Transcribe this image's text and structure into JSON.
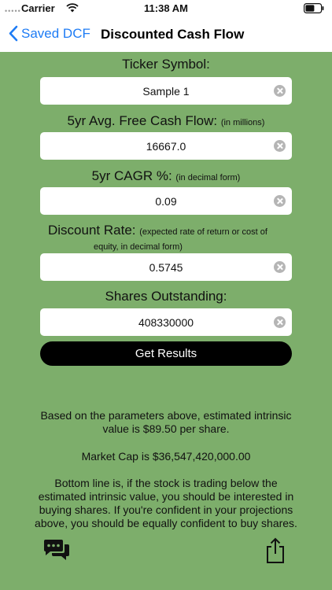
{
  "status": {
    "dots": "•••••",
    "carrier": "Carrier",
    "time": "11:38 AM"
  },
  "nav": {
    "back_label": "Saved DCF",
    "title": "Discounted Cash Flow"
  },
  "form": {
    "ticker": {
      "label": "Ticker Symbol:",
      "value": "Sample 1"
    },
    "fcf": {
      "label": "5yr Avg. Free Cash Flow:",
      "hint": "(in millions)",
      "value": "16667.0"
    },
    "cagr": {
      "label": "5yr CAGR %:",
      "hint": "(in decimal form)",
      "value": "0.09"
    },
    "discount": {
      "label": "Discount Rate:",
      "hint_line1": "(expected rate of return or cost of",
      "hint_line2": "equity, in decimal form)",
      "value": "0.5745"
    },
    "shares": {
      "label": "Shares Outstanding:",
      "value": "408330000"
    }
  },
  "button": {
    "label": "Get Results"
  },
  "results": {
    "intrinsic": "Based on the parameters above, estimated intrinsic value is $89.50 per share.",
    "market_cap": "Market Cap is $36,547,420,000.00",
    "bottom_line": "Bottom line is, if the stock is trading below the estimated intrinsic value, you should be interested in buying shares. If you're confident in your projections above, you should be equally confident to buy shares."
  },
  "icons": {
    "chat": "chat-bubbles-icon",
    "share": "share-icon"
  },
  "colors": {
    "background": "#7dae6b",
    "accent": "#1e7cf5",
    "button": "#000000"
  }
}
